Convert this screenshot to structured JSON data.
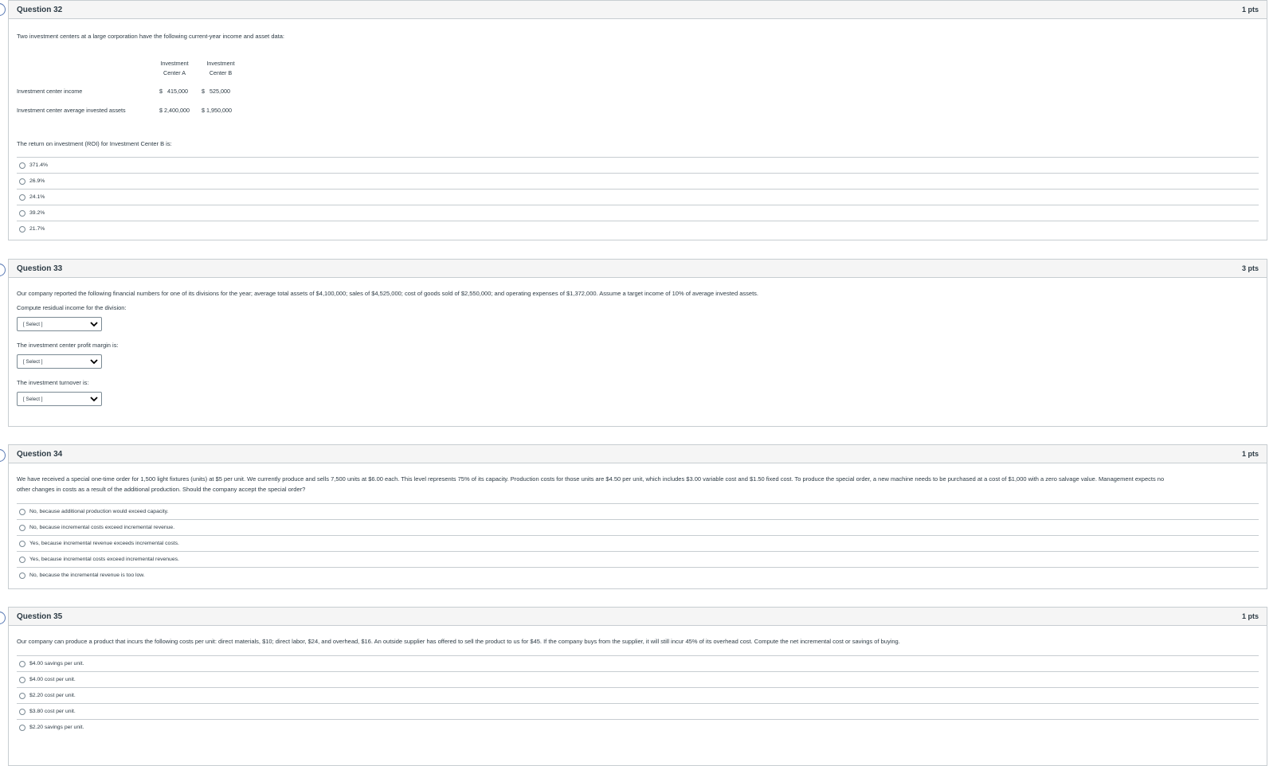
{
  "q32": {
    "title": "Question 32",
    "pts": "1 pts",
    "prompt": "Two investment centers at a large corporation have the following current-year income and asset data:",
    "table": {
      "col_a": [
        "Investment",
        "Center A"
      ],
      "col_b": [
        "Investment",
        "Center B"
      ],
      "rows": [
        {
          "label": "Investment center income",
          "a": "$   415,000",
          "b": "$   525,000"
        },
        {
          "label": "Investment center average invested assets",
          "a": "$ 2,400,000",
          "b": "$ 1,950,000"
        }
      ]
    },
    "question": "The return on investment (ROI) for Investment Center B is:",
    "answers": [
      "371.4%",
      "26.9%",
      "24.1%",
      "39.2%",
      "21.7%"
    ]
  },
  "q33": {
    "title": "Question 33",
    "pts": "3 pts",
    "prompt": "Our company reported the following financial numbers for one of its divisions for the year; average total assets of $4,100,000; sales of $4,525,000; cost of goods sold of $2,550,000; and operating expenses of $1,372,000. Assume a target income of 10% of average invested assets.",
    "parts": [
      {
        "label": "Compute residual income for the division:",
        "select": "[ Select ]"
      },
      {
        "label": "The investment center profit margin is:",
        "select": "[ Select ]"
      },
      {
        "label": "The investment turnover is:",
        "select": "[ Select ]"
      }
    ]
  },
  "q34": {
    "title": "Question 34",
    "pts": "1 pts",
    "prompt_line1": "We have received a special one-time order for 1,500 light fixtures (units) at $5 per unit. We currently produce and sells 7,500 units at $6.00 each. This level represents 75% of its capacity. Production costs for those units are $4.50 per unit, which includes $3.00 variable cost and $1.50 fixed cost. To produce the special order, a new machine needs to be purchased at a cost of $1,000 with a zero salvage value. Management expects no",
    "prompt_line2": "other changes in costs as a result of the additional production. Should the company accept the special order?",
    "answers": [
      "No, because additional production would exceed capacity.",
      "No, because incremental costs exceed incremental revenue.",
      "Yes, because incremental revenue exceeds incremental costs.",
      "Yes, because incremental costs exceed incremental revenues.",
      "No, because the incremental revenue is too low."
    ]
  },
  "q35": {
    "title": "Question 35",
    "pts": "1 pts",
    "prompt": "Our company can produce a product that incurs the following costs per unit: direct materials, $10; direct labor, $24, and overhead, $16. An outside supplier has offered to sell the product to us for $45. If the company buys from the supplier, it will still incur 45% of its overhead cost. Compute the net incremental cost or savings of buying.",
    "answers": [
      "$4.00 savings per unit.",
      "$4.00 cost per unit.",
      "$2.20 cost per unit.",
      "$3.80 cost per unit.",
      "$2.20 savings per unit."
    ]
  }
}
